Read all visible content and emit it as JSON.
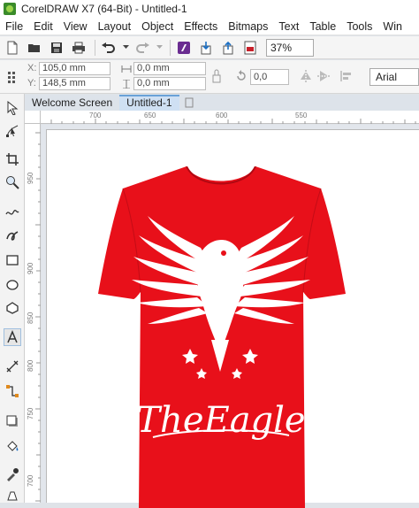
{
  "window": {
    "title": "CorelDRAW X7 (64-Bit) - Untitled-1"
  },
  "menu": [
    "File",
    "Edit",
    "View",
    "Layout",
    "Object",
    "Effects",
    "Bitmaps",
    "Text",
    "Table",
    "Tools",
    "Win"
  ],
  "toolbar": {
    "zoom": "37%"
  },
  "property_bar": {
    "x_label": "X:",
    "x_value": "105,0 mm",
    "y_label": "Y:",
    "y_value": "148,5 mm",
    "width_value": "0,0 mm",
    "height_value": "0,0 mm",
    "rotation_value": "0,0",
    "font": "Arial"
  },
  "tabs": {
    "welcome": "Welcome Screen",
    "document": "Untitled-1"
  },
  "ruler": {
    "horizontal": [
      "700",
      "650",
      "600",
      "550"
    ],
    "vertical": [
      "950",
      "900",
      "850",
      "800",
      "750",
      "700"
    ]
  },
  "design": {
    "text": "TheEagle",
    "shirt_color": "#e8101a",
    "print_color": "#ffffff"
  },
  "colors": {
    "accent": "#6aa2d8",
    "ui_bg": "#f5f5f5"
  }
}
